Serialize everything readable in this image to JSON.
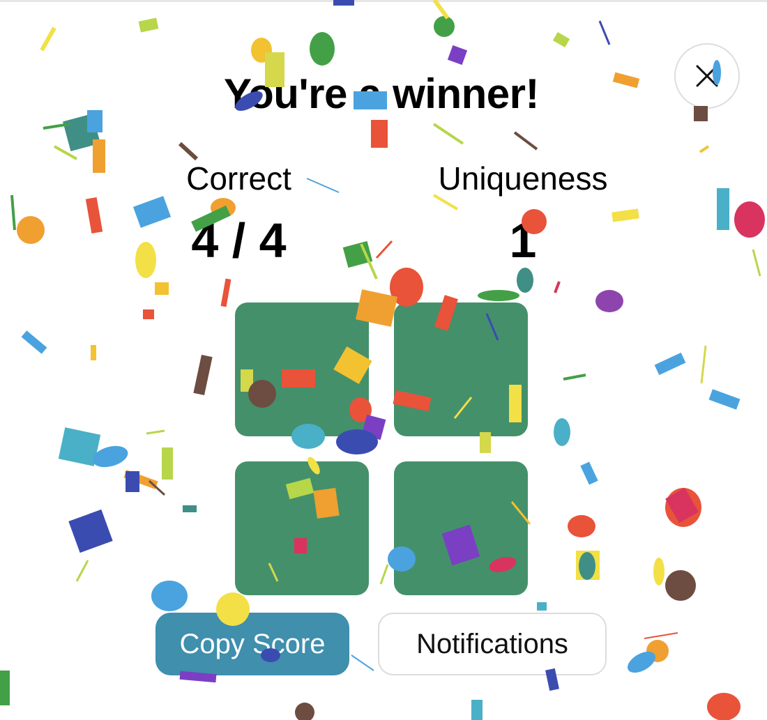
{
  "modal": {
    "title": "You're a winner!",
    "close_label": "close"
  },
  "stats": {
    "correct_label": "Correct",
    "correct_value": "4 / 4",
    "uniqueness_label": "Uniqueness",
    "uniqueness_value": "1"
  },
  "grid": {
    "tiles": [
      "correct",
      "correct",
      "correct",
      "correct"
    ]
  },
  "buttons": {
    "copy_score": "Copy Score",
    "notifications": "Notifications"
  },
  "colors": {
    "tile": "#44906b",
    "copy_button": "#3f8fad",
    "confetti": [
      "#e8533a",
      "#f2c230",
      "#4aa3df",
      "#3b4cb0",
      "#43a047",
      "#8e44ad",
      "#f0a030",
      "#6d4c41",
      "#d8345f",
      "#b7d64a",
      "#4ab0c8",
      "#7b3fc4"
    ]
  },
  "icons": {
    "close": "close-icon"
  }
}
